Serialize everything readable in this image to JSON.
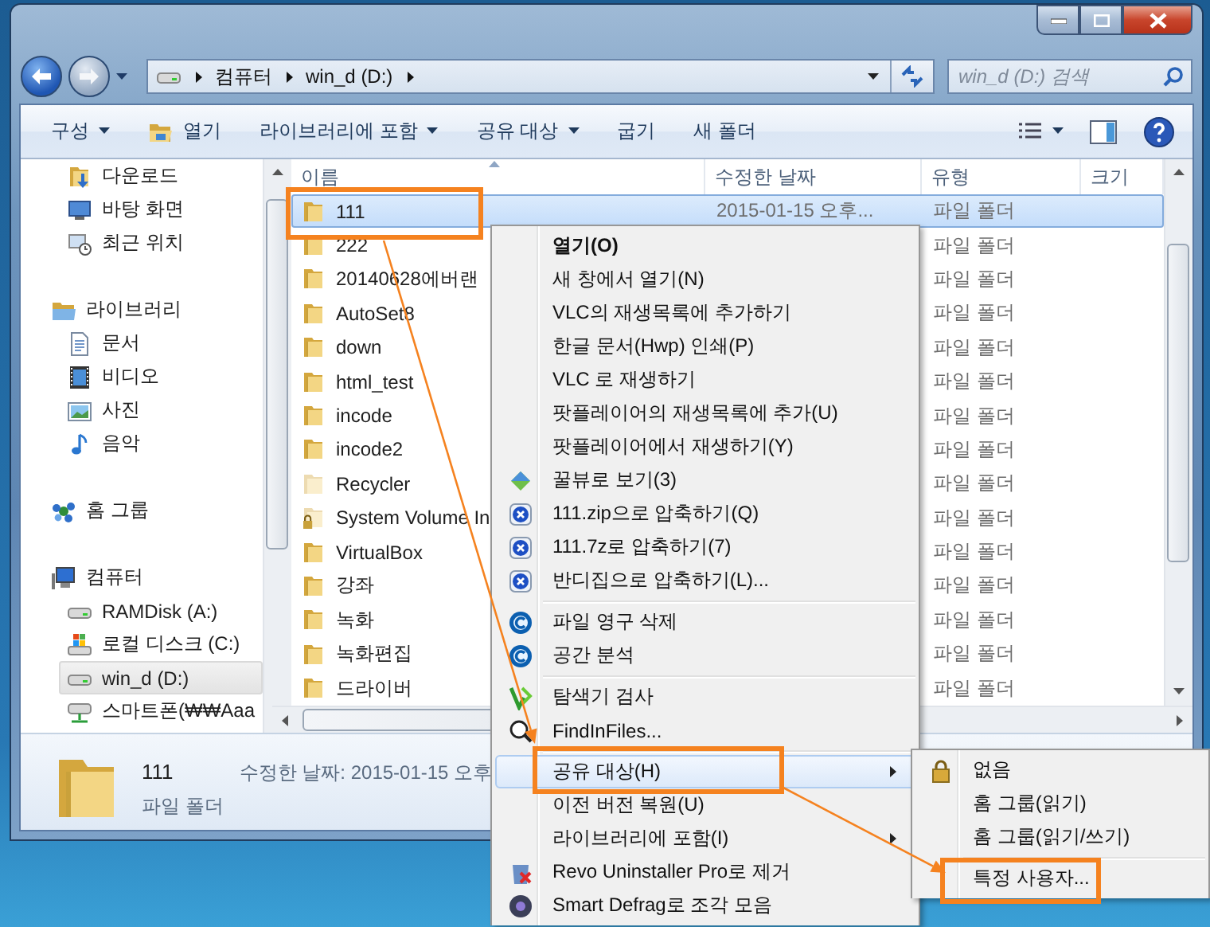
{
  "address_bar": {
    "crumbs": [
      "컴퓨터",
      "win_d (D:)"
    ]
  },
  "search": {
    "placeholder": "win_d (D:) 검색"
  },
  "command_bar": [
    {
      "label": "구성",
      "kind": "plain",
      "dropdown": true
    },
    {
      "label": "열기",
      "kind": "open",
      "dropdown": false
    },
    {
      "label": "라이브러리에 포함",
      "kind": "plain",
      "dropdown": true
    },
    {
      "label": "공유 대상",
      "kind": "plain",
      "dropdown": true
    },
    {
      "label": "굽기",
      "kind": "plain",
      "dropdown": false
    },
    {
      "label": "새 폴더",
      "kind": "plain",
      "dropdown": false
    }
  ],
  "nav_pane": {
    "groups": [
      {
        "children": [
          {
            "label": "다운로드",
            "kind": "download",
            "selected": false
          },
          {
            "label": "바탕 화면",
            "kind": "desktop",
            "selected": false
          },
          {
            "label": "최근 위치",
            "kind": "recent",
            "selected": false
          }
        ]
      },
      {
        "label": "라이브러리",
        "kind": "library",
        "selected": false,
        "children": [
          {
            "label": "문서",
            "kind": "document",
            "selected": false
          },
          {
            "label": "비디오",
            "kind": "video",
            "selected": false
          },
          {
            "label": "사진",
            "kind": "picture",
            "selected": false
          },
          {
            "label": "음악",
            "kind": "music",
            "selected": false
          }
        ]
      },
      {
        "label": "홈 그룹",
        "kind": "homegroup",
        "selected": false
      },
      {
        "label": "컴퓨터",
        "kind": "computer",
        "selected": false,
        "children": [
          {
            "label": "RAMDisk (A:)",
            "kind": "drive",
            "selected": false
          },
          {
            "label": "로컬 디스크 (C:)",
            "kind": "system-drive",
            "selected": false
          },
          {
            "label": "win_d (D:)",
            "kind": "drive",
            "selected": true
          },
          {
            "label": "스마트폰(₩₩Aaa",
            "kind": "network-drive",
            "selected": false
          }
        ]
      }
    ]
  },
  "file_list": {
    "columns": [
      "이름",
      "수정한 날짜",
      "유형",
      "크기"
    ],
    "rows": [
      {
        "name": "111",
        "kind": "folder",
        "modified": "2015-01-15 오후...",
        "type": "파일 폴더",
        "selected": true
      },
      {
        "name": "222",
        "kind": "folder",
        "type": "파일 폴더",
        "selected": false
      },
      {
        "name": "20140628에버랜",
        "kind": "folder",
        "type": "파일 폴더",
        "selected": false
      },
      {
        "name": "AutoSet8",
        "kind": "folder",
        "type": "파일 폴더",
        "selected": false
      },
      {
        "name": "down",
        "kind": "folder",
        "type": "파일 폴더",
        "selected": false
      },
      {
        "name": "html_test",
        "kind": "folder",
        "type": "파일 폴더",
        "selected": false
      },
      {
        "name": "incode",
        "kind": "folder",
        "type": "파일 폴더",
        "selected": false
      },
      {
        "name": "incode2",
        "kind": "folder",
        "type": "파일 폴더",
        "selected": false
      },
      {
        "name": "Recycler",
        "kind": "hidden-folder",
        "type": "파일 폴더",
        "selected": false
      },
      {
        "name": "System Volume In",
        "kind": "locked-folder",
        "type": "파일 폴더",
        "selected": false
      },
      {
        "name": "VirtualBox",
        "kind": "folder",
        "type": "파일 폴더",
        "selected": false
      },
      {
        "name": "강좌",
        "kind": "folder",
        "type": "파일 폴더",
        "selected": false
      },
      {
        "name": "녹화",
        "kind": "folder",
        "type": "파일 폴더",
        "selected": false
      },
      {
        "name": "녹화편집",
        "kind": "folder",
        "type": "파일 폴더",
        "selected": false
      },
      {
        "name": "드라이버",
        "kind": "folder",
        "type": "파일 폴더",
        "selected": false
      }
    ]
  },
  "details": {
    "name": "111",
    "type": "파일 폴더",
    "modified": "수정한 날짜: 2015-01-15 오후"
  },
  "context_menu": {
    "groups": [
      [
        {
          "label": "열기(O)",
          "kind": "plain",
          "default": true,
          "submenu": false,
          "selected": false
        },
        {
          "label": "새 창에서 열기(N)",
          "kind": "plain",
          "default": false,
          "submenu": false,
          "selected": false
        },
        {
          "label": "VLC의 재생목록에 추가하기",
          "kind": "plain",
          "default": false,
          "submenu": false,
          "selected": false
        },
        {
          "label": "한글 문서(Hwp) 인쇄(P)",
          "kind": "plain",
          "default": false,
          "submenu": false,
          "selected": false
        },
        {
          "label": "VLC 로 재생하기",
          "kind": "plain",
          "default": false,
          "submenu": false,
          "selected": false
        },
        {
          "label": "팟플레이어의 재생목록에 추가(U)",
          "kind": "plain",
          "default": false,
          "submenu": false,
          "selected": false
        },
        {
          "label": "팟플레이어에서 재생하기(Y)",
          "kind": "plain",
          "default": false,
          "submenu": false,
          "selected": false
        },
        {
          "label": "꿀뷰로 보기(3)",
          "kind": "viewer",
          "default": false,
          "submenu": false,
          "selected": false
        },
        {
          "label": "111.zip으로 압축하기(Q)",
          "kind": "archive",
          "default": false,
          "submenu": false,
          "selected": false
        },
        {
          "label": "111.7z로 압축하기(7)",
          "kind": "archive",
          "default": false,
          "submenu": false,
          "selected": false
        },
        {
          "label": "반디집으로 압축하기(L)...",
          "kind": "archive",
          "default": false,
          "submenu": false,
          "selected": false
        }
      ],
      [
        {
          "label": "파일 영구 삭제",
          "kind": "cleaner",
          "default": false,
          "submenu": false,
          "selected": false
        },
        {
          "label": "공간 분석",
          "kind": "cleaner",
          "default": false,
          "submenu": false,
          "selected": false
        }
      ],
      [
        {
          "label": "탐색기 검사",
          "kind": "scan",
          "default": false,
          "submenu": false,
          "selected": false
        },
        {
          "label": "FindInFiles...",
          "kind": "finder",
          "default": false,
          "submenu": false,
          "selected": false
        }
      ],
      [
        {
          "label": "공유 대상(H)",
          "kind": "plain",
          "default": false,
          "submenu": true,
          "selected": true
        },
        {
          "label": "이전 버전 복원(U)",
          "kind": "plain",
          "default": false,
          "submenu": false,
          "selected": false
        },
        {
          "label": "라이브러리에 포함(I)",
          "kind": "plain",
          "default": false,
          "submenu": true,
          "selected": false
        },
        {
          "label": "Revo Uninstaller Pro로 제거",
          "kind": "uninstall",
          "default": false,
          "submenu": false,
          "selected": false
        },
        {
          "label": "Smart Defrag로 조각 모음",
          "kind": "defrag",
          "default": false,
          "submenu": false,
          "selected": false
        }
      ]
    ]
  },
  "submenu": {
    "groups": [
      [
        {
          "label": "없음",
          "kind": "lock",
          "selected": false
        },
        {
          "label": "홈 그룹(읽기)",
          "kind": "plain",
          "selected": false
        },
        {
          "label": "홈 그룹(읽기/쓰기)",
          "kind": "plain",
          "selected": false
        }
      ],
      [
        {
          "label": "특정 사용자...",
          "kind": "plain",
          "selected": false
        }
      ]
    ]
  }
}
